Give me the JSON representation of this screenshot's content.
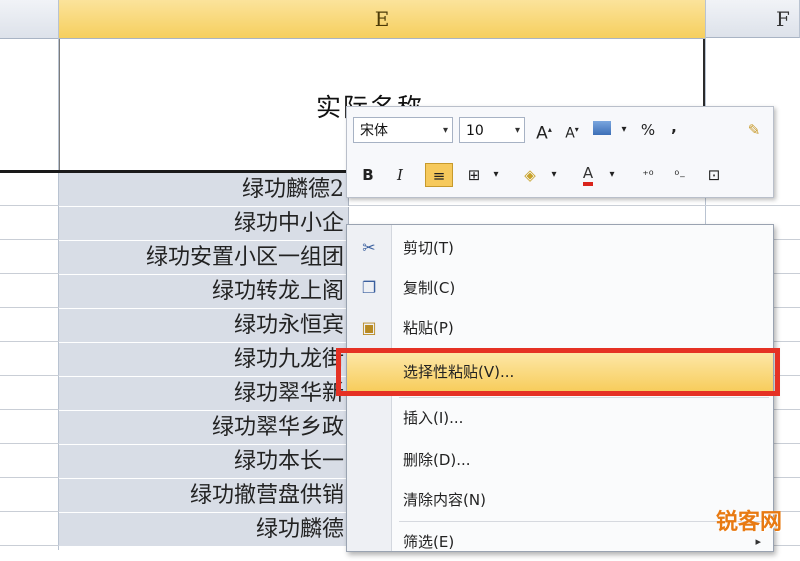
{
  "sheet": {
    "columns": {
      "left": "",
      "e": "E",
      "f": "F"
    },
    "header_cell": "实际名称",
    "rows": [
      "绿功麟德2",
      "绿功中小企",
      "绿功安置小区一组团",
      "绿功转龙上阁",
      "绿功永恒宾",
      "绿功九龙街",
      "绿功翠华新",
      "绿功翠华乡政",
      "绿功本长一",
      "绿功撤营盘供销",
      "绿功麟德"
    ]
  },
  "minitoolbar": {
    "font_name": "宋体",
    "font_size": "10",
    "grow_font": "A",
    "shrink_font": "A",
    "percent": "%",
    "comma": ",",
    "bold": "B",
    "italic": "I",
    "font_color": "A"
  },
  "context_menu": {
    "items": [
      {
        "label": "剪切(T)",
        "icon": "scissors-icon"
      },
      {
        "label": "复制(C)",
        "icon": "copy-icon"
      },
      {
        "label": "粘贴(P)",
        "icon": "paste-icon"
      },
      {
        "label": "选择性粘贴(V)...",
        "icon": ""
      },
      {
        "label": "插入(I)...",
        "icon": ""
      },
      {
        "label": "删除(D)...",
        "icon": ""
      },
      {
        "label": "清除内容(N)",
        "icon": ""
      },
      {
        "label": "筛选(E)",
        "icon": ""
      }
    ],
    "highlighted_index": 3
  },
  "watermark": "锐客网",
  "colors": {
    "highlight": "#f7cd5c",
    "redbox": "#e53124",
    "selected_cells": "#d8dde6"
  }
}
